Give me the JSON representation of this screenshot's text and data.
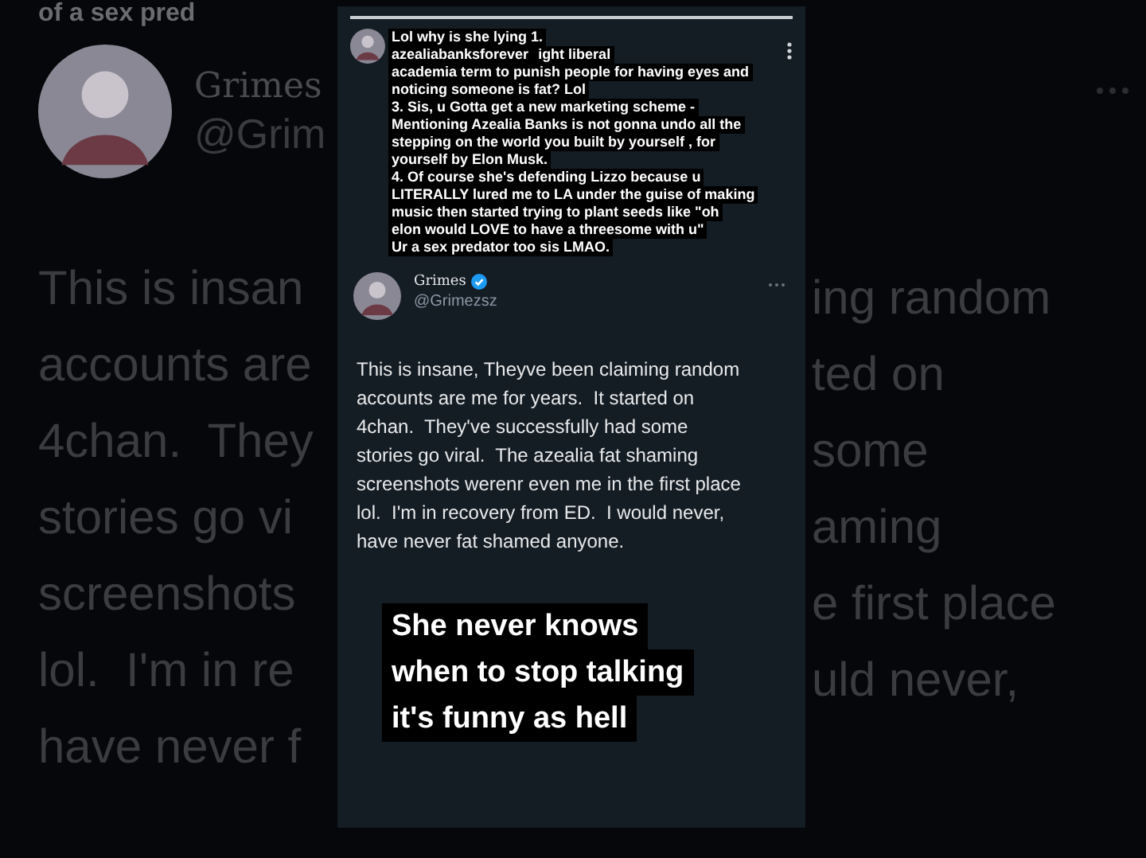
{
  "background": {
    "top_text": "of a sex pred",
    "display_name": "Grimes",
    "handle": "@Grim",
    "left_lines": [
      "This is insan",
      "accounts are",
      "4chan.  They",
      "stories go vi",
      "screenshots",
      "lol.  I'm in re",
      "have never f"
    ],
    "right_lines": [
      "ing random",
      "ted on",
      "some",
      "aming",
      "e first place",
      "uld never,"
    ]
  },
  "post": {
    "quote": {
      "first_line": "Lol why is she lying 1.",
      "handle": "azealiabanksforever",
      "handle_line_tail": "ight liberal",
      "lines": [
        "academia term to punish people for having eyes and",
        "noticing someone is fat? Lol",
        "3. Sis, u Gotta get a new marketing scheme -",
        "Mentioning Azealia Banks is not gonna undo all the",
        "stepping on the world you built by yourself , for",
        "yourself by Elon Musk.",
        "4. Of course she's defending Lizzo because u",
        "LITERALLY lured me to LA under the guise of making",
        "music then started trying to plant seeds like \"oh",
        "elon would LOVE to have a threesome with u\"",
        "Ur a sex predator too sis LMAO."
      ]
    },
    "author": {
      "name": "Grimes",
      "handle": "@Grimezsz",
      "verified": true
    },
    "body_lines": [
      "This is insane, Theyve been claiming random",
      "accounts are me for years.  It started on",
      "4chan.  They've successfully had some",
      "stories go viral.  The azealia fat shaming",
      "screenshots werenr even me in the first place",
      "lol.  I'm in recovery from ED.  I would never,",
      "have never fat shamed anyone."
    ],
    "caption_lines": [
      "She never knows",
      "when to stop talking",
      "it's funny as hell"
    ]
  }
}
